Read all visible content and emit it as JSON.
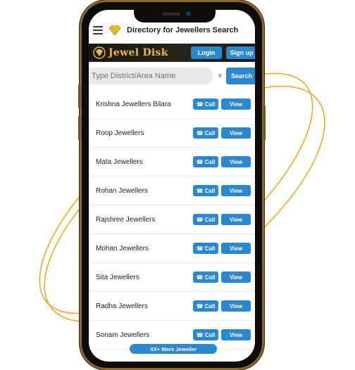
{
  "header": {
    "title": "Directory for Jewellers Search"
  },
  "brand": {
    "name": "Jewel Disk",
    "login_label": "Login",
    "signup_label": "Sign up"
  },
  "search": {
    "placeholder": "Type District/Area Name",
    "caret": "v",
    "button_label": "Search"
  },
  "listing": {
    "call_label": "Call",
    "view_label": "View",
    "items": [
      {
        "name": "Krishna Jewellers Bilara"
      },
      {
        "name": "Roop Jewellers"
      },
      {
        "name": "Mata Jewellers"
      },
      {
        "name": "Rohan Jewellers"
      },
      {
        "name": "Rajshree Jewellers"
      },
      {
        "name": "Mohan Jewellers"
      },
      {
        "name": "Sita Jewellers"
      },
      {
        "name": "Radha Jewellers"
      },
      {
        "name": "Sonam Jewellers"
      }
    ],
    "more_label": "XX+ More Jeweller"
  },
  "colors": {
    "accent": "#2c87d1",
    "brand_gold": "#e7b94a",
    "orbit": "#f2a51a",
    "phone_frame": "#8a6a2a"
  },
  "icons": {
    "menu": "hamburger-icon",
    "logo": "diamond-icon",
    "call": "phone-icon"
  }
}
